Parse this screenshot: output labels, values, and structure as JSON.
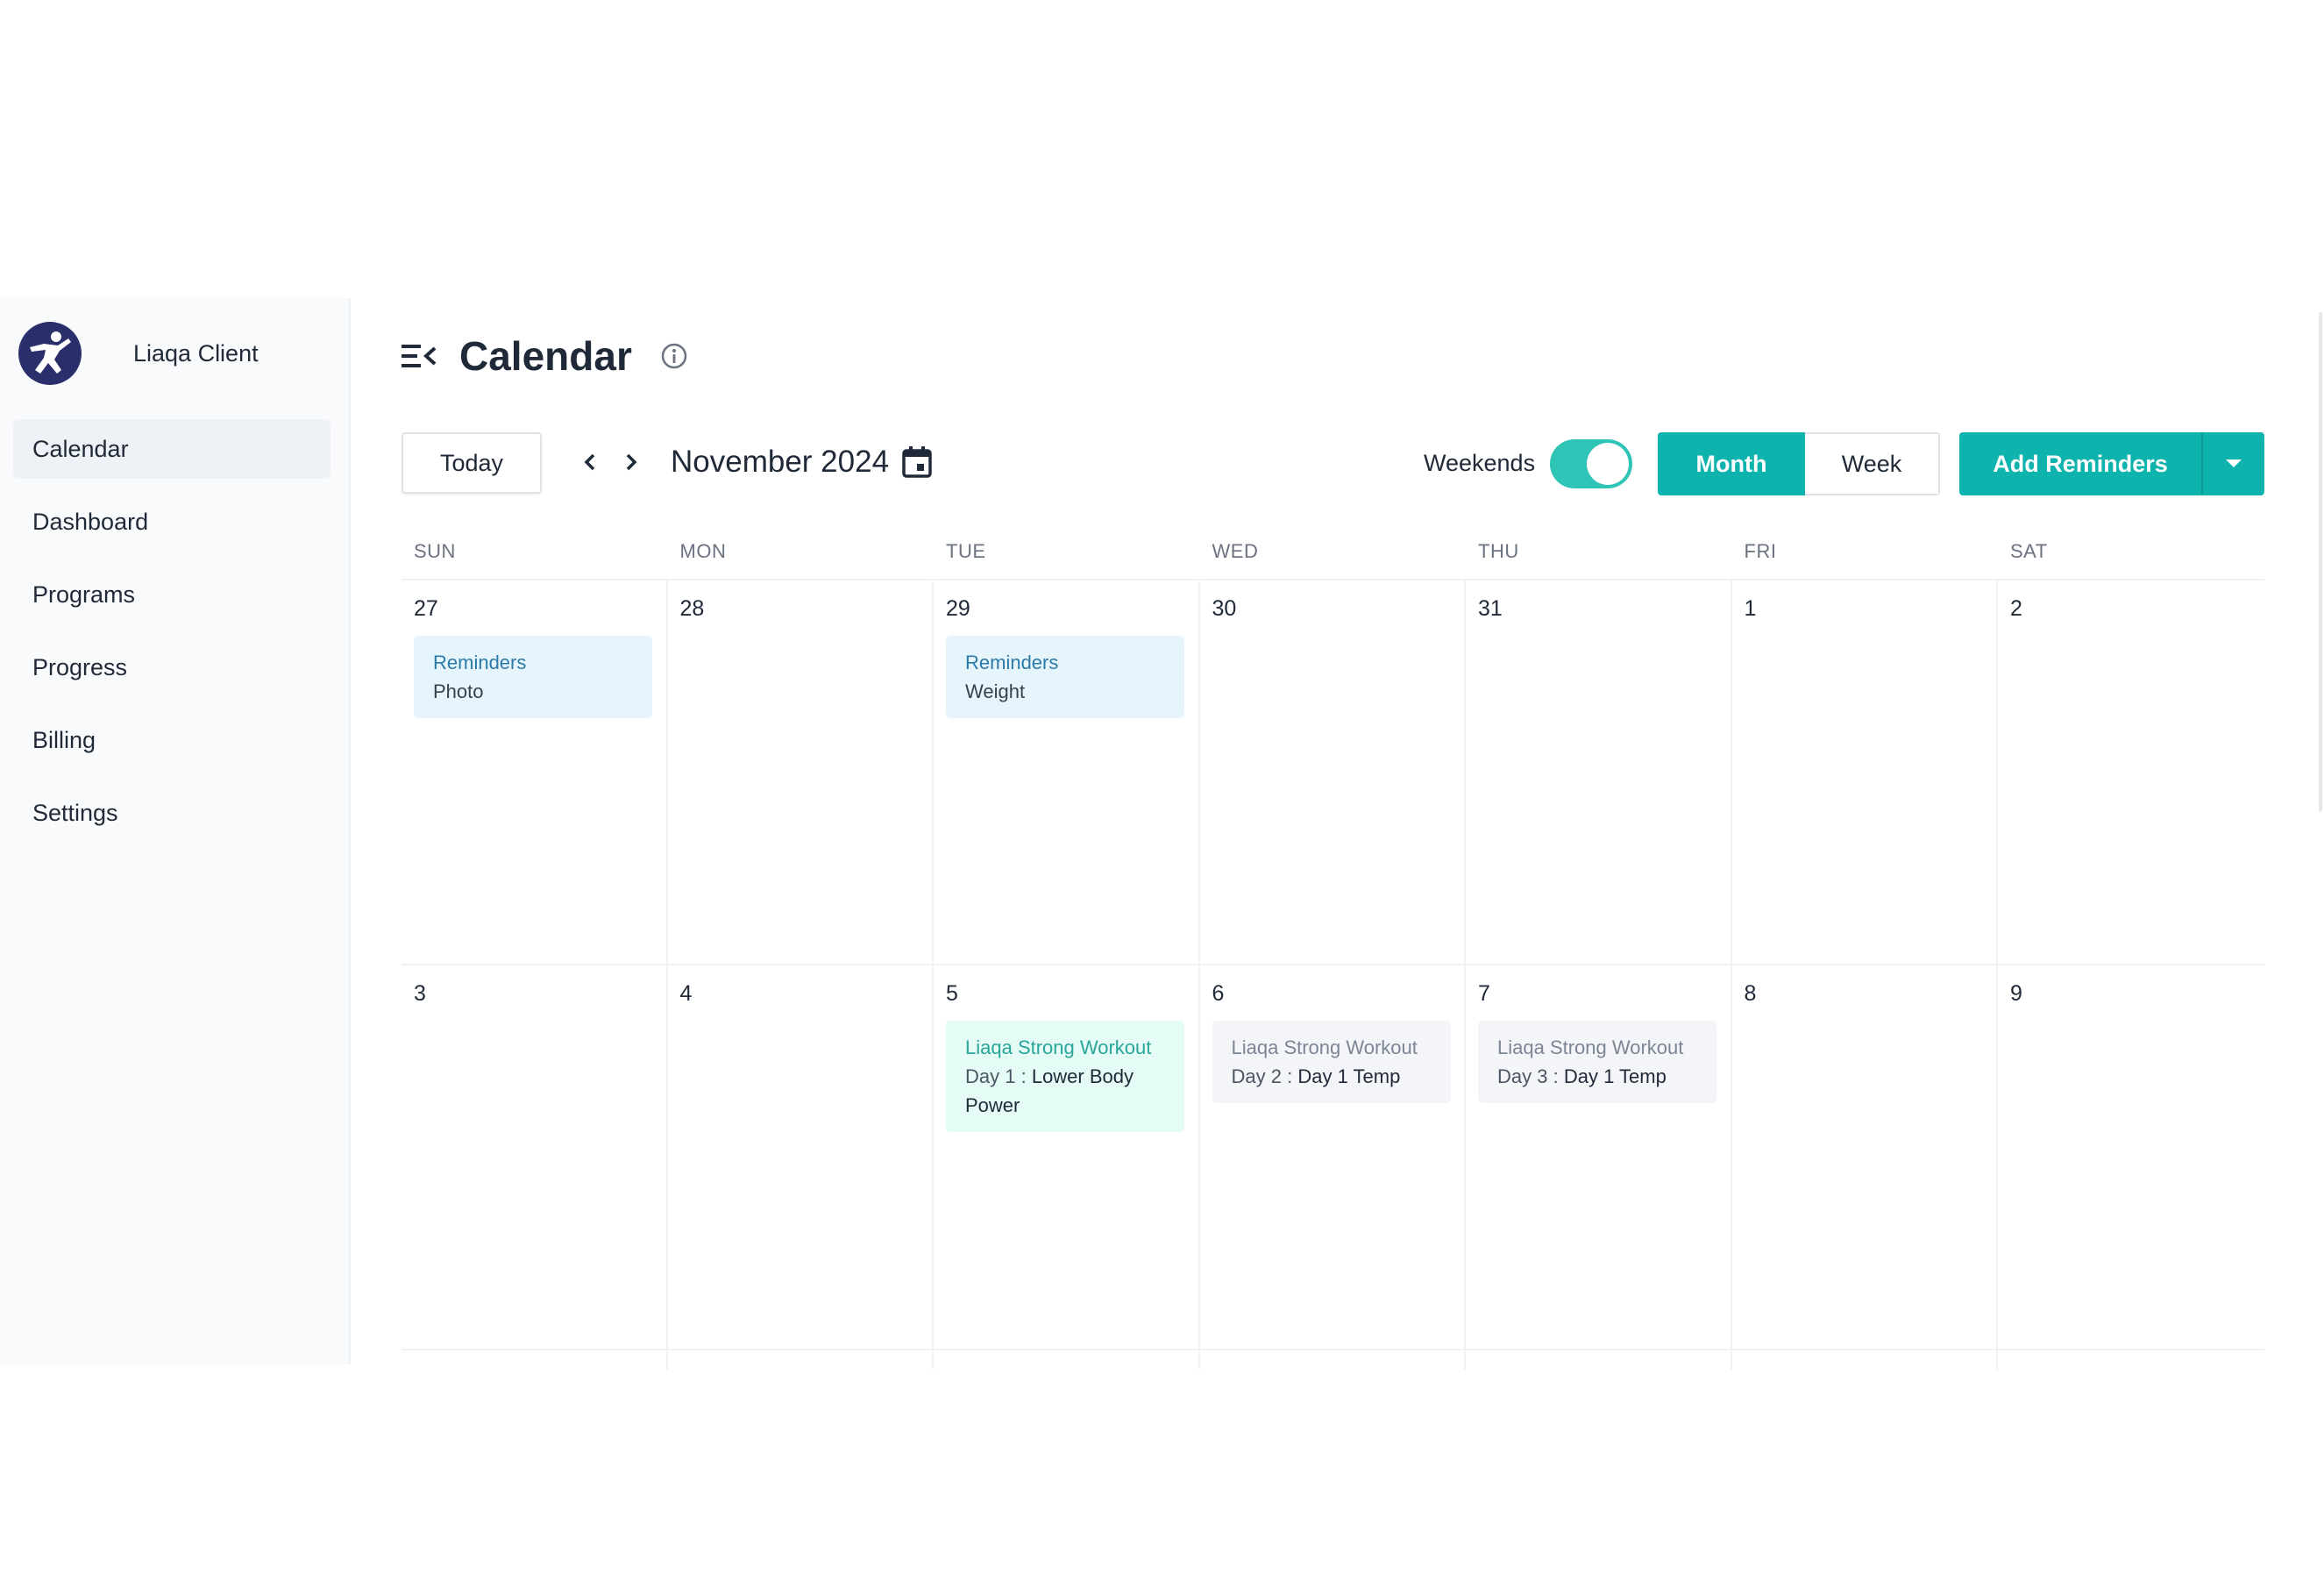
{
  "brand": {
    "name": "Liaqa Client",
    "logo_icon": "running-person-logo",
    "logo_color": "#2a2f6b"
  },
  "sidebar": {
    "items": [
      {
        "label": "Calendar",
        "active": true
      },
      {
        "label": "Dashboard"
      },
      {
        "label": "Programs"
      },
      {
        "label": "Progress"
      },
      {
        "label": "Billing"
      },
      {
        "label": "Settings"
      }
    ]
  },
  "header": {
    "title": "Calendar",
    "collapse_icon": "menu-collapse-icon",
    "info_icon": "info-circle-icon"
  },
  "toolbar": {
    "today_label": "Today",
    "month_label": "November 2024",
    "weekends_label": "Weekends",
    "weekends_on": true,
    "views": {
      "month": "Month",
      "week": "Week",
      "selected": "Month"
    },
    "add_label": "Add Reminders",
    "accent": "#0fb3ad"
  },
  "calendar": {
    "days_of_week": [
      "SUN",
      "MON",
      "TUE",
      "WED",
      "THU",
      "FRI",
      "SAT"
    ],
    "week1": {
      "dates": [
        "27",
        "28",
        "29",
        "30",
        "31",
        "1",
        "2"
      ],
      "sun_event": {
        "title": "Reminders",
        "sub": "Photo"
      },
      "tue_event": {
        "title": "Reminders",
        "sub": "Weight"
      }
    },
    "week2": {
      "dates": [
        "3",
        "4",
        "5",
        "6",
        "7",
        "8",
        "9"
      ],
      "tue_event": {
        "title": "Liaqa Strong Workout",
        "day": "Day 1",
        "name": "Lower Body Power"
      },
      "wed_event": {
        "title": "Liaqa Strong Workout",
        "day": "Day 2",
        "name": "Day 1 Temp"
      },
      "thu_event": {
        "title": "Liaqa Strong Workout",
        "day": "Day 3",
        "name": "Day 1 Temp"
      }
    },
    "separator": " : "
  }
}
